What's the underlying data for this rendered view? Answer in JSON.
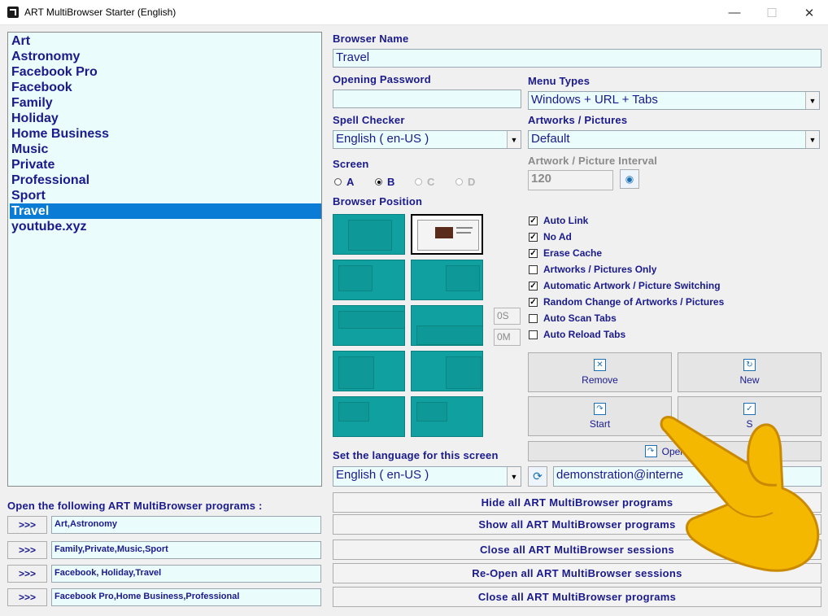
{
  "window": {
    "title": "ART MultiBrowser Starter (English)",
    "minimize": "—",
    "maximize": "☐",
    "close": "✕"
  },
  "browser_list": {
    "items": [
      "Art",
      "Astronomy",
      "Facebook Pro",
      "Facebook",
      "Family",
      "Holiday",
      "Home Business",
      "Music",
      "Private",
      "Professional",
      "Sport",
      "Travel",
      "youtube.xyz"
    ],
    "selected": "Travel"
  },
  "form": {
    "browser_name_label": "Browser Name",
    "browser_name_value": "Travel",
    "opening_password_label": "Opening Password",
    "opening_password_value": "",
    "menu_types_label": "Menu Types",
    "menu_types_value": "Windows + URL + Tabs",
    "spell_checker_label": "Spell Checker",
    "spell_checker_value": "English ( en-US )",
    "artworks_label": "Artworks / Pictures",
    "artworks_value": "Default",
    "screen_label": "Screen",
    "screen_options": [
      "A",
      "B",
      "C",
      "D"
    ],
    "screen_selected": "B",
    "interval_label": "Artwork / Picture Interval",
    "interval_value": "120",
    "browser_position_label": "Browser Position",
    "pos_seconds": "0S",
    "pos_minutes": "0M",
    "language_label": "Set the language for this screen",
    "language_value": "English ( en-US )",
    "email_value": "demonstration@interne"
  },
  "options": [
    {
      "label": "Auto Link",
      "checked": true
    },
    {
      "label": "No Ad",
      "checked": true
    },
    {
      "label": "Erase Cache",
      "checked": true
    },
    {
      "label": "Artworks / Pictures Only",
      "checked": false
    },
    {
      "label": "Automatic Artwork / Picture Switching",
      "checked": true
    },
    {
      "label": "Random Change of Artworks / Pictures",
      "checked": true
    },
    {
      "label": "Auto Scan Tabs",
      "checked": false
    },
    {
      "label": "Auto Reload Tabs",
      "checked": false
    }
  ],
  "buttons": {
    "remove": "Remove",
    "new": "New",
    "start": "Start",
    "save_partial": "S",
    "open_your": "Open You"
  },
  "programs": {
    "label": "Open the following ART MultiBrowser programs :",
    "go_label": ">>>",
    "rows": [
      "Art,Astronomy",
      "Family,Private,Music,Sport",
      "Facebook, Holiday,Travel",
      "Facebook Pro,Home Business,Professional"
    ]
  },
  "actions": [
    "Hide all ART MultiBrowser programs",
    "Show all ART MultiBrowser programs",
    "Close all ART MultiBrowser sessions",
    "Re-Open all ART MultiBrowser sessions",
    "Close all ART MultiBrowser programs"
  ],
  "colors": {
    "accent": "#0a7cd6",
    "text": "#1a1a8c",
    "field_bg": "#eafcfc",
    "thumb": "#11a0a0",
    "pointer_hand": "#f5b800"
  }
}
